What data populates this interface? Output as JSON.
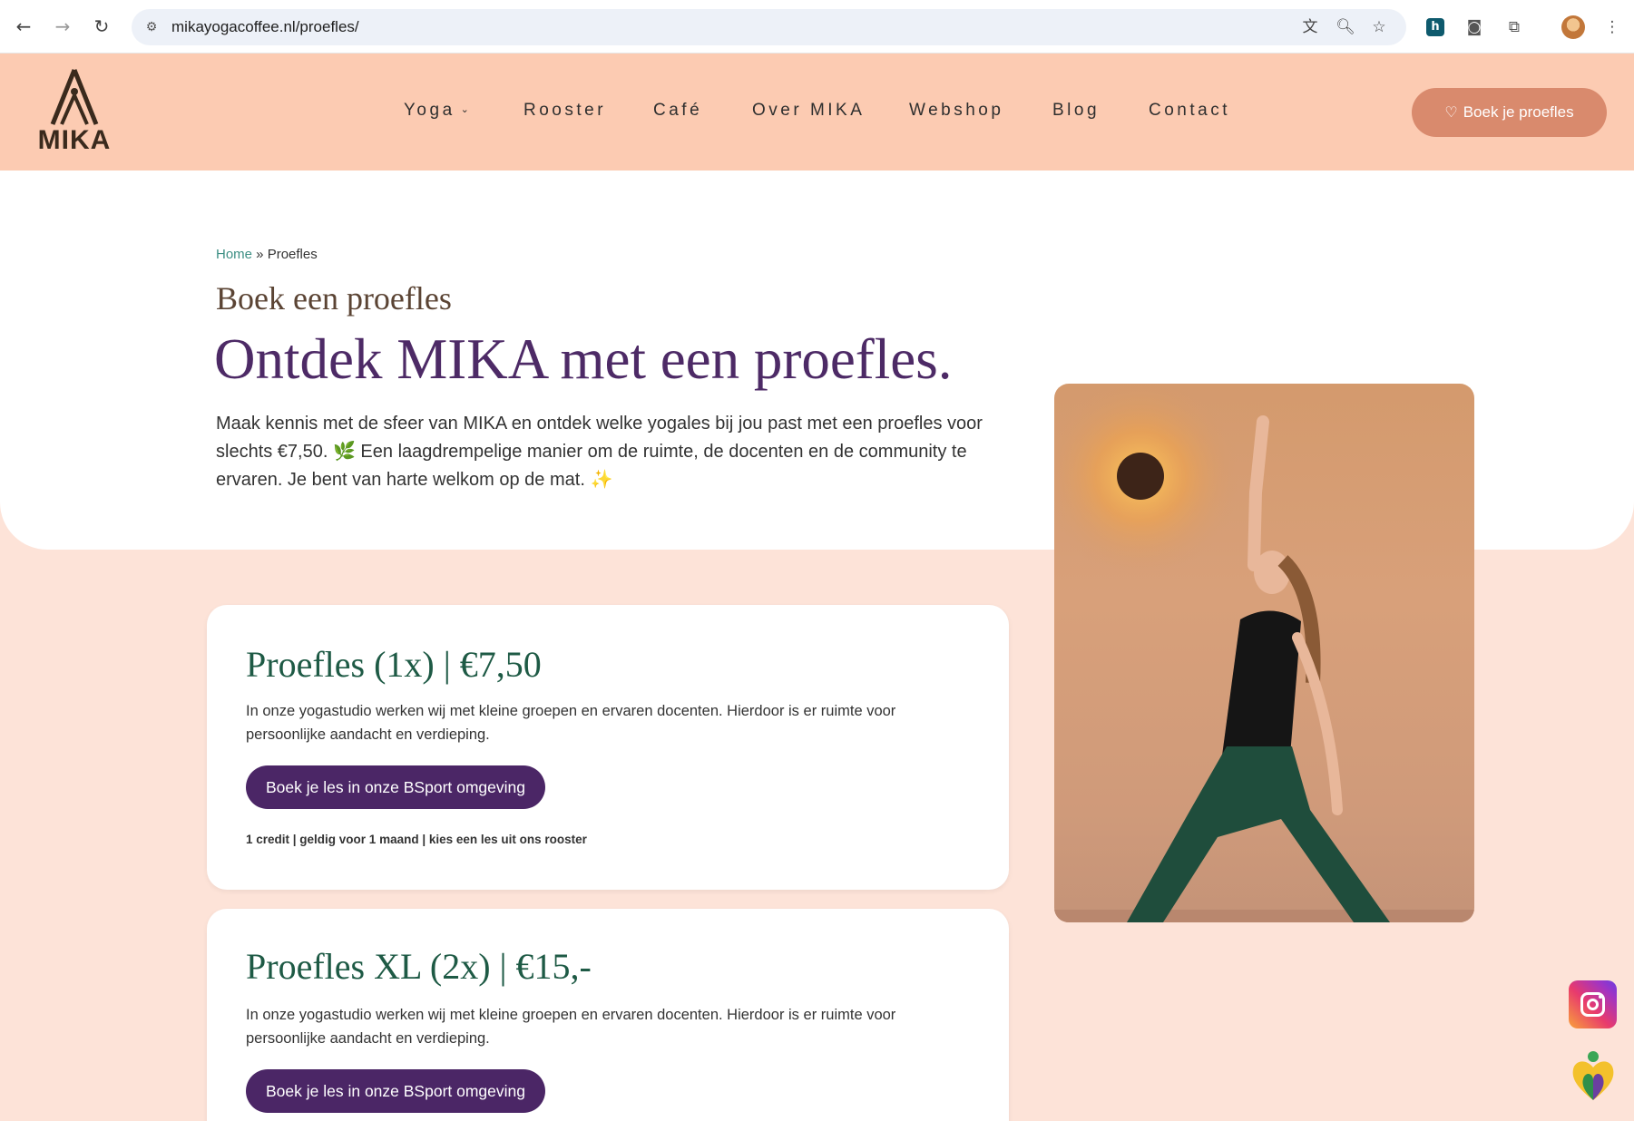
{
  "browser": {
    "url": "mikayogacoffee.nl/proefles/",
    "icons": [
      "back-icon",
      "forward-icon",
      "reload-icon",
      "site-info-icon",
      "translate-icon",
      "zoom-icon",
      "star-icon",
      "extension-icon",
      "camera-icon",
      "puzzle-icon",
      "profile-avatar",
      "more-icon"
    ]
  },
  "header": {
    "logo_text": "MIKA",
    "menu": [
      {
        "label": "Yoga",
        "has_dropdown": true
      },
      {
        "label": "Rooster"
      },
      {
        "label": "Café"
      },
      {
        "label": "Over MIKA"
      },
      {
        "label": "Webshop"
      },
      {
        "label": "Blog"
      },
      {
        "label": "Contact"
      }
    ],
    "cta_label": "Boek je proefles"
  },
  "hero": {
    "breadcrumb_home": "Home",
    "breadcrumb_sep": " » ",
    "breadcrumb_current": "Proefles",
    "eyebrow": "Boek een proefles",
    "headline": "Ontdek MIKA met een proefles.",
    "intro_part1": "Maak kennis met de sfeer van MIKA en ontdek welke yogales bij jou past met een proefles voor slechts €7,50. ",
    "intro_emoji1": "🌿",
    "intro_part2": " Een laagdrempelige manier om de ruimte, de docenten en de community te ervaren. Je bent van harte welkom op de mat. ",
    "intro_emoji2": "✨"
  },
  "cards": [
    {
      "title": "Proefles (1x) | €7,50",
      "text": "In onze yogastudio werken wij met kleine groepen en ervaren docenten. Hierdoor is er ruimte voor persoonlijke aandacht en verdieping.",
      "button": "Boek je les in onze BSport omgeving",
      "note": "1 credit | geldig voor 1 maand | kies een les uit ons rooster"
    },
    {
      "title": "Proefles XL (2x) | €15,-",
      "text": "In onze yogastudio werken wij met kleine groepen en ervaren docenten. Hierdoor is er ruimte voor persoonlijke aandacht en verdieping.",
      "button": "Boek je les in onze BSport omgeving"
    }
  ],
  "colors": {
    "header_bg": "#fccbb2",
    "page_bg": "#fde3d8",
    "cta": "#d98a6d",
    "headline": "#4d2a66",
    "card_title": "#1e5a45",
    "button": "#4b2666"
  }
}
